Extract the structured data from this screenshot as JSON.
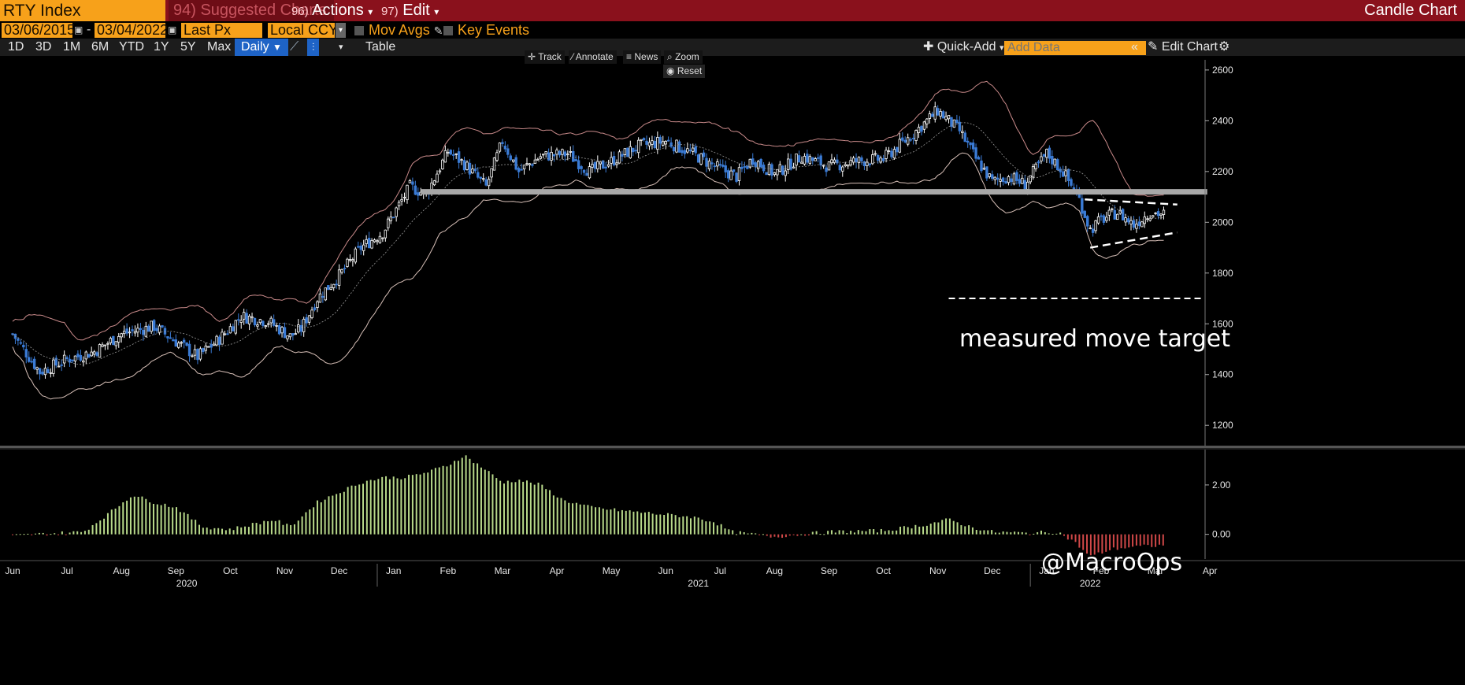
{
  "header": {
    "ticker": "RTY Index",
    "suggested_num": "94)",
    "suggested": "Suggested Charts",
    "actions_num": "96)",
    "actions": "Actions",
    "edit_num": "97)",
    "edit": "Edit",
    "chart_type": "Candle Chart"
  },
  "settings": {
    "start_date": "03/06/2015",
    "end_date": "03/04/2022",
    "price_field": "Last Px",
    "currency": "Local CCY",
    "mov_avgs": "Mov Avgs",
    "key_events": "Key Events"
  },
  "toolbar": {
    "periods": [
      "1D",
      "3D",
      "1M",
      "6M",
      "YTD",
      "1Y",
      "5Y",
      "Max"
    ],
    "frequency": "Daily",
    "table": "Table",
    "quick_add": "Quick-Add",
    "add_data_placeholder": "Add Data",
    "edit_chart": "Edit Chart"
  },
  "chart_tools": {
    "track": "Track",
    "annotate": "Annotate",
    "news": "News",
    "zoom": "Zoom",
    "reset": "Reset"
  },
  "colors": {
    "header_bg": "#8a111c",
    "accent": "#f7a11a",
    "selected": "#1e63c6",
    "candle_up": "#ffffff",
    "candle_down": "#3a7bd5",
    "band": "#c98a8a",
    "lower_band": "#d8c0b8",
    "osc_pos": "#b8d98a",
    "osc_neg": "#d04848"
  },
  "annotations": {
    "target_text": "measured move target",
    "handle": "@MacroOps"
  },
  "chart_data": [
    {
      "type": "candlestick",
      "series": [
        {
          "name": "RTY Index"
        },
        {
          "name": "Bollinger upper"
        },
        {
          "name": "Bollinger middle"
        },
        {
          "name": "Bollinger lower"
        }
      ],
      "ylim": [
        1120,
        2640
      ],
      "yticks": [
        1200,
        1400,
        1600,
        1800,
        2000,
        2200,
        2400,
        2600
      ],
      "xticks": [
        "Jun",
        "Jul",
        "Aug",
        "Sep",
        "Oct",
        "Nov",
        "Dec",
        "Jan",
        "Feb",
        "Mar",
        "Apr",
        "May",
        "Jun",
        "Jul",
        "Aug",
        "Sep",
        "Oct",
        "Nov",
        "Dec",
        "Jan",
        "Feb",
        "Mar",
        "Apr"
      ],
      "year_labels": [
        "2020",
        "2021",
        "2022"
      ],
      "grid": false,
      "close_path": [
        [
          0,
          1560
        ],
        [
          0.5,
          1410
        ],
        [
          1,
          1460
        ],
        [
          1.5,
          1490
        ],
        [
          2,
          1560
        ],
        [
          2.6,
          1590
        ],
        [
          3,
          1530
        ],
        [
          3.4,
          1470
        ],
        [
          3.8,
          1540
        ],
        [
          4.2,
          1630
        ],
        [
          4.7,
          1610
        ],
        [
          5.1,
          1550
        ],
        [
          5.3,
          1580
        ],
        [
          5.6,
          1700
        ],
        [
          6.0,
          1790
        ],
        [
          6.4,
          1900
        ],
        [
          6.8,
          1960
        ],
        [
          7.3,
          2140
        ],
        [
          7.6,
          2110
        ],
        [
          8.0,
          2280
        ],
        [
          8.3,
          2230
        ],
        [
          8.7,
          2140
        ],
        [
          9.0,
          2320
        ],
        [
          9.3,
          2200
        ],
        [
          9.7,
          2260
        ],
        [
          10.2,
          2270
        ],
        [
          10.6,
          2200
        ],
        [
          11.0,
          2240
        ],
        [
          11.5,
          2300
        ],
        [
          12.0,
          2320
        ],
        [
          12.5,
          2270
        ],
        [
          12.9,
          2220
        ],
        [
          13.3,
          2180
        ],
        [
          13.6,
          2250
        ],
        [
          14.0,
          2190
        ],
        [
          14.5,
          2260
        ],
        [
          15.0,
          2220
        ],
        [
          15.5,
          2240
        ],
        [
          16.0,
          2250
        ],
        [
          16.5,
          2340
        ],
        [
          17.0,
          2440
        ],
        [
          17.4,
          2360
        ],
        [
          17.7,
          2250
        ],
        [
          18.0,
          2160
        ],
        [
          18.3,
          2180
        ],
        [
          18.6,
          2150
        ],
        [
          19.0,
          2270
        ],
        [
          19.3,
          2200
        ],
        [
          19.6,
          2090
        ],
        [
          19.8,
          1970
        ],
        [
          20.0,
          2010
        ],
        [
          20.3,
          2040
        ],
        [
          20.6,
          1990
        ],
        [
          20.9,
          2040
        ],
        [
          21.2,
          2030
        ]
      ],
      "horizontal_support": 2120,
      "triangle": {
        "upper": [
          [
            19.7,
            2090
          ],
          [
            21.4,
            2070
          ]
        ],
        "lower": [
          [
            19.8,
            1900
          ],
          [
            21.4,
            1960
          ]
        ]
      },
      "measured_move_target": 1700
    },
    {
      "type": "bar",
      "name": "oscillator",
      "ylim": [
        -1.0,
        3.4
      ],
      "yticks": [
        0.0,
        2.0
      ],
      "ytick_labels": [
        "0.00",
        "2.00"
      ],
      "profile": [
        [
          0,
          -0.05
        ],
        [
          1.3,
          0.1
        ],
        [
          1.8,
          0.9
        ],
        [
          2.2,
          1.6
        ],
        [
          2.6,
          1.3
        ],
        [
          3.0,
          1.1
        ],
        [
          3.5,
          0.3
        ],
        [
          4.0,
          0.2
        ],
        [
          4.4,
          0.4
        ],
        [
          4.8,
          0.6
        ],
        [
          5.1,
          0.3
        ],
        [
          5.3,
          0.7
        ],
        [
          5.6,
          1.3
        ],
        [
          6.0,
          1.7
        ],
        [
          6.4,
          2.1
        ],
        [
          6.8,
          2.3
        ],
        [
          7.2,
          2.3
        ],
        [
          7.6,
          2.5
        ],
        [
          8.0,
          2.8
        ],
        [
          8.3,
          3.2
        ],
        [
          8.7,
          2.6
        ],
        [
          9.0,
          2.1
        ],
        [
          9.3,
          2.2
        ],
        [
          9.7,
          2.0
        ],
        [
          10.1,
          1.4
        ],
        [
          10.6,
          1.1
        ],
        [
          11.0,
          1.0
        ],
        [
          11.5,
          0.9
        ],
        [
          12.0,
          0.8
        ],
        [
          12.5,
          0.7
        ],
        [
          12.9,
          0.5
        ],
        [
          13.2,
          0.1
        ],
        [
          13.6,
          0.0
        ],
        [
          14.0,
          -0.1
        ],
        [
          15.0,
          0.1
        ],
        [
          16.0,
          0.15
        ],
        [
          16.8,
          0.4
        ],
        [
          17.2,
          0.6
        ],
        [
          17.6,
          0.3
        ],
        [
          18.0,
          0.1
        ],
        [
          18.6,
          0.05
        ],
        [
          19.2,
          0.1
        ],
        [
          19.5,
          -0.3
        ],
        [
          19.8,
          -0.9
        ],
        [
          20.2,
          -0.6
        ],
        [
          20.6,
          -0.5
        ],
        [
          21.2,
          -0.45
        ]
      ]
    }
  ]
}
